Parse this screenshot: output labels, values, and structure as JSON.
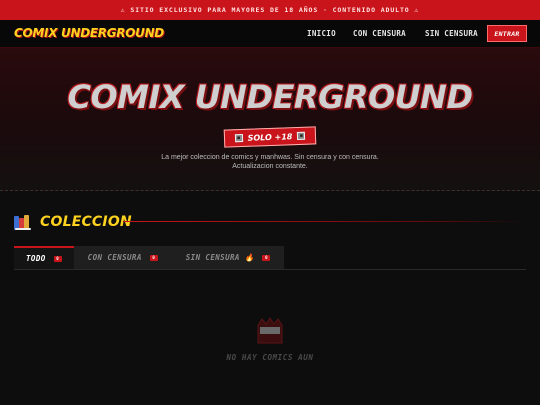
{
  "warning_bar": {
    "text": "⚠ SITIO EXCLUSIVO PARA MAYORES DE 18 AÑOS · CONTENIDO ADULTO ⚠"
  },
  "nav": {
    "logo": "COMIX UNDERGROUND",
    "links": [
      "INICIO",
      "CON CENSURA",
      "SIN CENSURA"
    ],
    "enter_label": "ENTRAR"
  },
  "hero": {
    "title": "COMIX UNDERGROUND",
    "badge": "SOLO +18",
    "subtitle_line1": "La mejor coleccion de comics y manhwas. Sin censura y con censura.",
    "subtitle_line2": "Actualizacion constante."
  },
  "collection": {
    "title": "COLECCION",
    "tabs": [
      {
        "label": "TODO",
        "count": "0"
      },
      {
        "label": "CON CENSURA",
        "count": "0"
      },
      {
        "label": "SIN CENSURA 🔥",
        "count": "0"
      }
    ],
    "empty_text": "NO HAY COMICS AUN"
  },
  "colors": {
    "accent_red": "#c8141a",
    "accent_yellow": "#ffd21f",
    "background": "#0d0d0d"
  },
  "icons": [
    "books-icon",
    "no-comics-icon",
    "censor-square-icon"
  ]
}
